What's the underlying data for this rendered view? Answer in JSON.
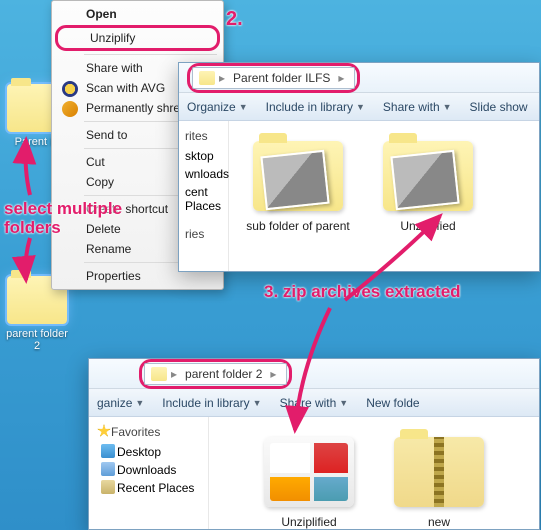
{
  "desktop": {
    "folder1": "Parent\nIL",
    "folder2": "parent folder 2"
  },
  "contextMenu": {
    "open": "Open",
    "unziplify": "Unziplify",
    "shareWith": "Share with",
    "scanAvg": "Scan with AVG",
    "shred": "Permanently shred with",
    "sendTo": "Send to",
    "cut": "Cut",
    "copy": "Copy",
    "shortcut": "Create shortcut",
    "delete": "Delete",
    "rename": "Rename",
    "properties": "Properties"
  },
  "annotations": {
    "step2": "2.",
    "step3": "3. zip archives extracted",
    "selectMulti": "select multiple folders"
  },
  "win1": {
    "breadcrumbLabel": "Parent folder ILFS",
    "cmd": {
      "organize": "Organize",
      "include": "Include in library",
      "share": "Share with",
      "slide": "Slide show"
    },
    "side": {
      "fav": "rites",
      "desktop": "sktop",
      "downloads": "wnloads",
      "recent": "cent Places",
      "libs": "ries"
    },
    "folders": {
      "a": "sub folder of parent",
      "b": "Unziplified"
    }
  },
  "win2": {
    "breadcrumbLabel": "parent folder 2",
    "cmd": {
      "organize": "ganize",
      "include": "Include in library",
      "share": "Share with",
      "new": "New folde"
    },
    "side": {
      "fav": "Favorites",
      "desktop": "Desktop",
      "downloads": "Downloads",
      "recent": "Recent Places"
    },
    "folders": {
      "a": "Unziplified",
      "b": "new"
    }
  }
}
